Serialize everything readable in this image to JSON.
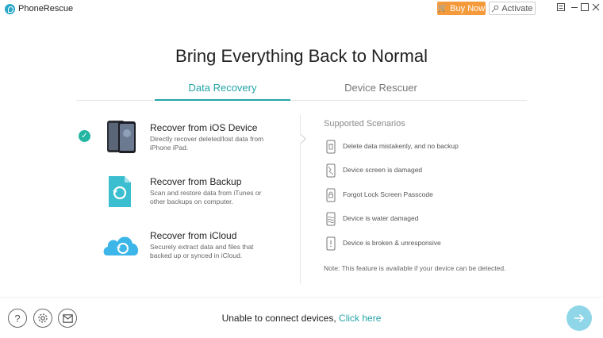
{
  "app": {
    "name": "PhoneRescue",
    "buy_label": "Buy Now",
    "activate_label": "Activate"
  },
  "headline": "Bring Everything Back to Normal",
  "tabs": [
    {
      "label": "Data Recovery",
      "active": true
    },
    {
      "label": "Device Rescuer",
      "active": false
    }
  ],
  "options": [
    {
      "title": "Recover from iOS Device",
      "desc": "Directly recover deleted/lost data from iPhone iPad.",
      "selected": true,
      "icon": "phone-icon"
    },
    {
      "title": "Recover from Backup",
      "desc": "Scan and restore data from iTunes or other backups on computer.",
      "selected": false,
      "icon": "backup-file-icon"
    },
    {
      "title": "Recover from iCloud",
      "desc": "Securely extract data and files that backed up or synced in iCloud.",
      "selected": false,
      "icon": "cloud-icon"
    }
  ],
  "scenarios": {
    "title": "Supported Scenarios",
    "items": [
      {
        "text": "Delete data mistakenly, and no backup",
        "icon": "trash-phone-icon"
      },
      {
        "text": "Device screen is damaged",
        "icon": "cracked-screen-icon"
      },
      {
        "text": "Forgot Lock Screen Passcode",
        "icon": "lock-phone-icon"
      },
      {
        "text": "Device is water damaged",
        "icon": "water-phone-icon"
      },
      {
        "text": "Device is broken & unresponsive",
        "icon": "broken-phone-icon"
      }
    ],
    "note": "Note: This feature is available if your device can be detected."
  },
  "footer": {
    "message": "Unable to connect devices,",
    "link": "Click here"
  },
  "colors": {
    "accent": "#25a4a8",
    "buy": "#f59a3b",
    "check": "#24b5a3",
    "next": "#8fd6e8"
  }
}
